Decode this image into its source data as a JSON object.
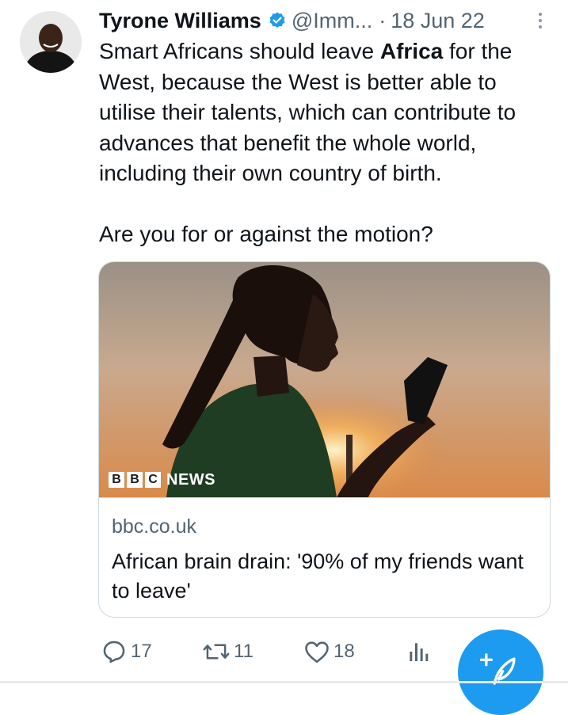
{
  "tweet": {
    "author": {
      "name": "Tyrone Williams",
      "handle": "@Imm...",
      "verified_icon": "verified-badge-icon"
    },
    "separator": "·",
    "date": "18 Jun 22",
    "text_paragraphs": [
      "Smart Africans should leave ",
      "Africa",
      " for the West, because the West is better able to utilise their talents, which can contribute to advances that benefit the whole world, including their own country of birth.",
      "Are you for or against the motion?"
    ]
  },
  "link_card": {
    "image_overlay": {
      "logo_letters": [
        "B",
        "B",
        "C"
      ],
      "logo_word": "NEWS"
    },
    "domain": "bbc.co.uk",
    "title": "African brain drain: '90% of my friends want to leave'"
  },
  "actions": {
    "replies": "17",
    "retweets": "11",
    "likes": "18"
  },
  "colors": {
    "accent": "#1d9bf0",
    "text": "#0f1419",
    "muted": "#536471",
    "border": "#cfd9de"
  }
}
